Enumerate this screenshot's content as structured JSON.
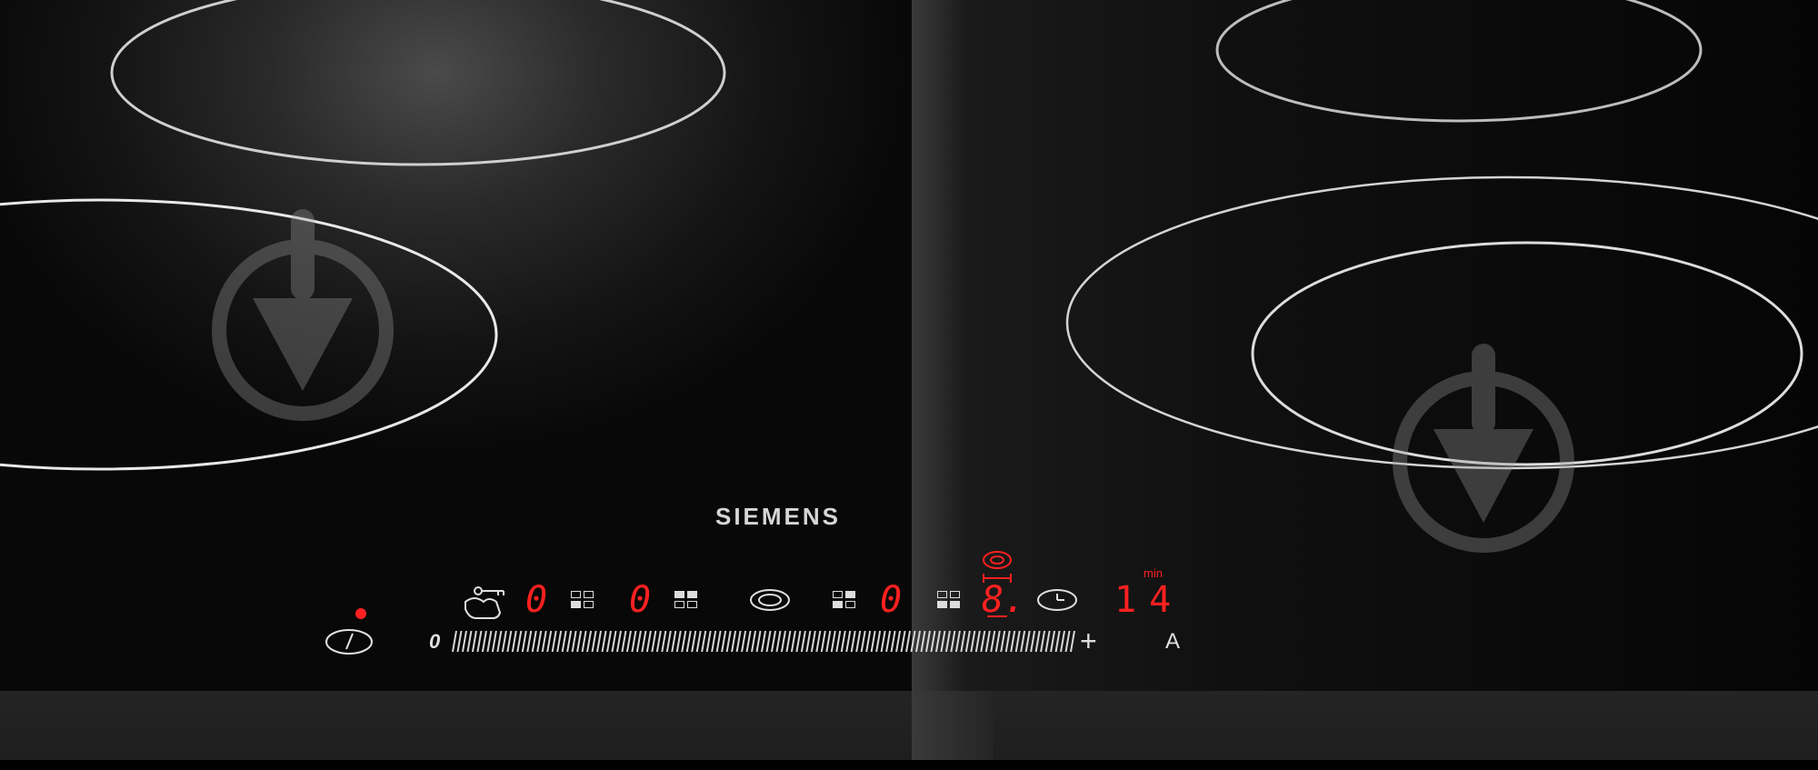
{
  "brand": {
    "name": "SIEMENS"
  },
  "display": {
    "zone_level_1": "0",
    "zone_level_2": "0",
    "zone_level_3": "0",
    "zone_level_4": "8.",
    "timer_value": "14",
    "timer_unit": "min"
  },
  "slider": {
    "min_label": "0",
    "plus_label": "+",
    "auto_label": "A"
  },
  "colors": {
    "led": "#ff2020",
    "glass": "#0b0b0b",
    "ring": "#d8d8d8"
  },
  "icons": [
    "power-icon",
    "child-lock-icon",
    "zone-grid-icon",
    "ring-select-icon",
    "clock-icon",
    "extended-zone-icon",
    "hot-indicator-icon"
  ]
}
